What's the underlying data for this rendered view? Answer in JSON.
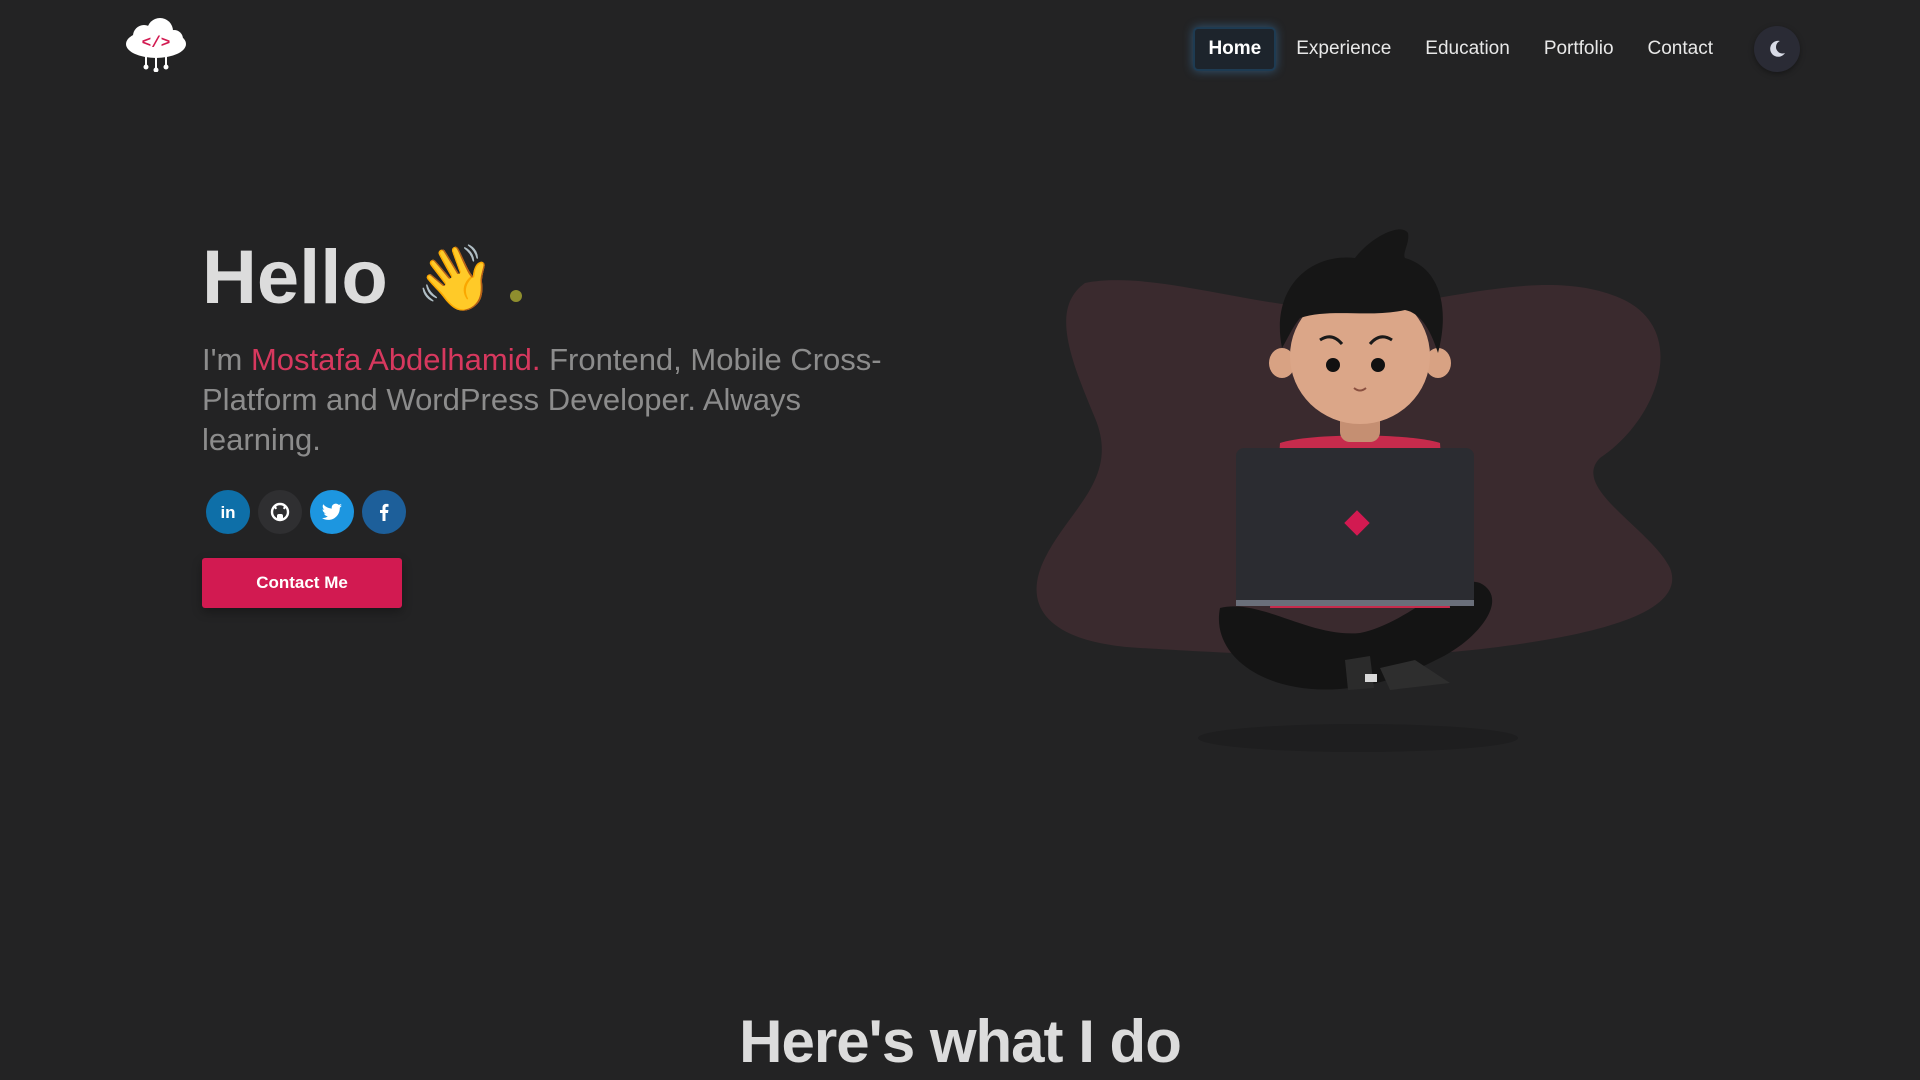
{
  "nav": {
    "items": [
      {
        "label": "Home",
        "active": true
      },
      {
        "label": "Experience",
        "active": false
      },
      {
        "label": "Education",
        "active": false
      },
      {
        "label": "Portfolio",
        "active": false
      },
      {
        "label": "Contact",
        "active": false
      }
    ],
    "theme_toggle_icon": "moon-icon"
  },
  "hero": {
    "greeting": "Hello",
    "wave_emoji": "👋",
    "intro_prefix": "I'm ",
    "name": "Mostafa Abdelhamid.",
    "intro_suffix": " Frontend, Mobile Cross-Platform and WordPress Developer. Always learning.",
    "socials": [
      {
        "name": "linkedin-icon",
        "color": "#0e6fa8"
      },
      {
        "name": "github-icon",
        "color": "#2f2f31"
      },
      {
        "name": "twitter-icon",
        "color": "#1d96e0"
      },
      {
        "name": "facebook-icon",
        "color": "#1d5f9a"
      }
    ],
    "cta_label": "Contact Me"
  },
  "section": {
    "title": "Here's what I do"
  },
  "colors": {
    "background": "#232324",
    "accent": "#d21a51",
    "name_highlight": "#d7385e",
    "blob": "#3a2a2e"
  }
}
